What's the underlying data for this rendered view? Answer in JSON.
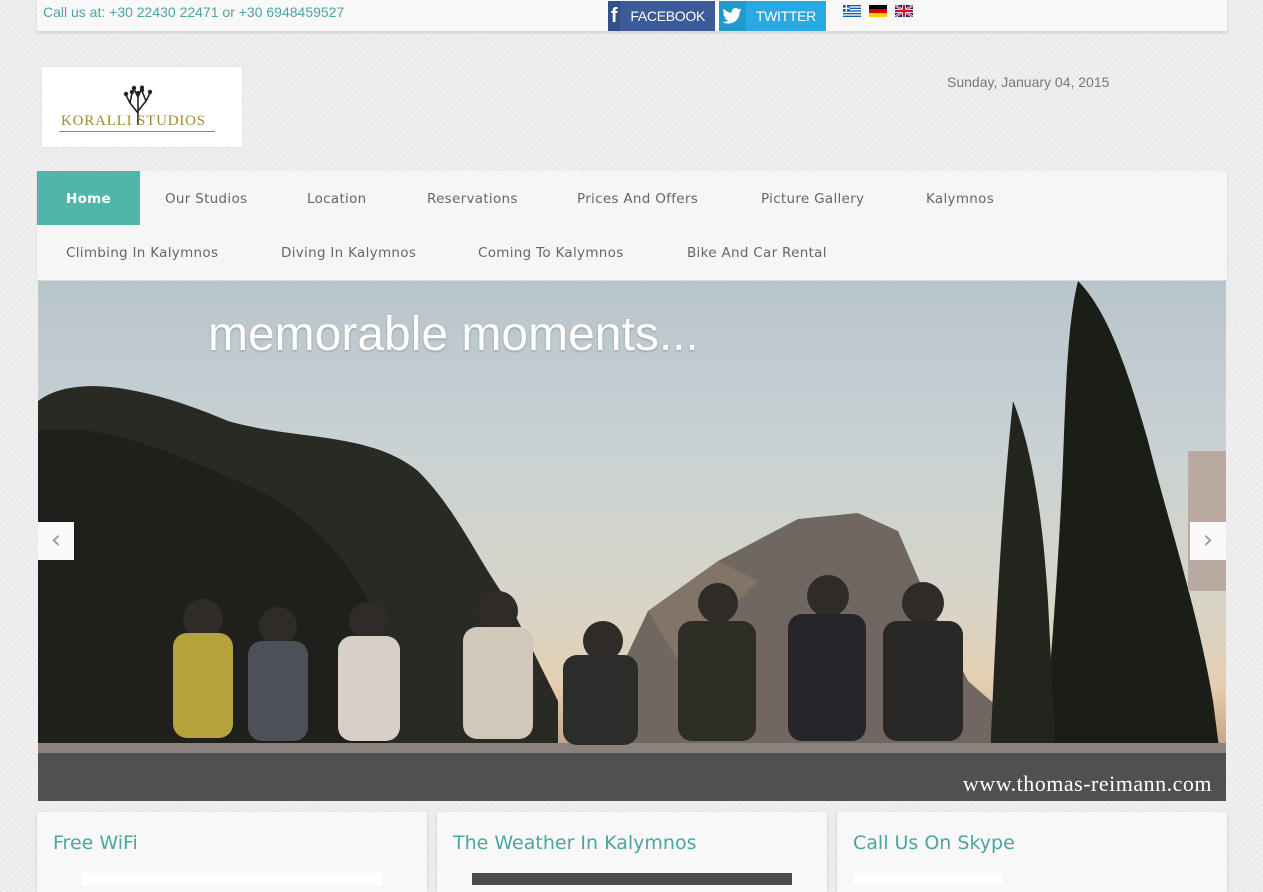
{
  "topbar": {
    "phone": "Call us at: +30 22430 22471 or +30 6948459527",
    "facebook_label": "FACEBOOK",
    "twitter_label": "TWITTER",
    "languages": [
      "Greek",
      "German",
      "English"
    ]
  },
  "header": {
    "logo_text": "KORALLI STUDIOS",
    "date": "Sunday, January 04, 2015"
  },
  "nav": {
    "items": [
      {
        "label": "Home",
        "active": true
      },
      {
        "label": "Our Studios"
      },
      {
        "label": "Location"
      },
      {
        "label": "Reservations"
      },
      {
        "label": "Prices And Offers"
      },
      {
        "label": "Picture Gallery"
      },
      {
        "label": "Kalymnos"
      },
      {
        "label": "Climbing In Kalymnos"
      },
      {
        "label": "Diving In Kalymnos"
      },
      {
        "label": "Coming To Kalymnos"
      },
      {
        "label": "Bike And Car Rental"
      }
    ]
  },
  "slider": {
    "caption": "memorable moments...",
    "watermark": "www.thomas-reimann.com",
    "prev_symbol": "‹",
    "next_symbol": "›"
  },
  "boxes": [
    {
      "title": "Free WiFi"
    },
    {
      "title": "The Weather In Kalymnos"
    },
    {
      "title": "Call Us On Skype"
    }
  ],
  "colors": {
    "accent": "#52b5aa",
    "link": "#4aa69f",
    "facebook": "#3b5b98",
    "twitter": "#28a9e1"
  }
}
